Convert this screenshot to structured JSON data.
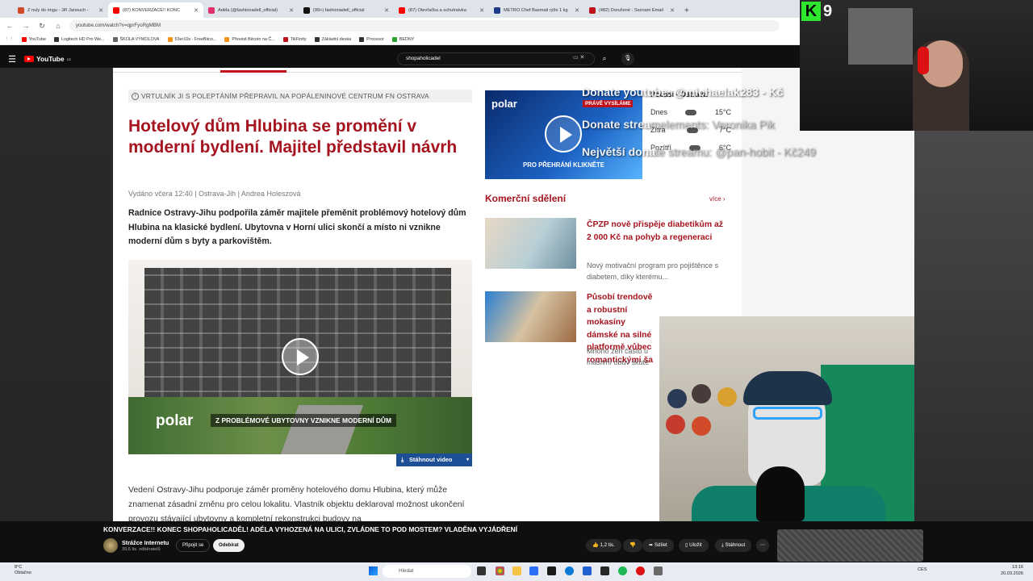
{
  "browser": {
    "tabs": [
      {
        "label": "Z nuly do ringu - Jiří Janouch -",
        "color": "#d04a2a",
        "active": false
      },
      {
        "label": "(87) KONVERZACE!! KONC",
        "color": "#ff0000",
        "active": true
      },
      {
        "label": "Adéla (@fashionadell_official)",
        "color": "#e1306c",
        "active": false
      },
      {
        "label": "(99+) fashionadell_official",
        "color": "#111111",
        "active": false
      },
      {
        "label": "(87) Otevřačka a ochutnávka",
        "color": "#ff0000",
        "active": false
      },
      {
        "label": "METRO Chef Basmati rýže 1 kg",
        "color": "#1a3a8a",
        "active": false
      },
      {
        "label": "(482) Doručené - Seznam Email",
        "color": "#c0121a",
        "active": false
      }
    ],
    "new_tab": "+",
    "url": "youtube.com/watch?v=qprFyoRgMBM",
    "bookmarks": [
      {
        "label": "YouTube",
        "color": "#ff0000"
      },
      {
        "label": "Logitech HD Pro We...",
        "color": "#333333"
      },
      {
        "label": "ŠKOLA VÝMOLOVA",
        "color": "#666666"
      },
      {
        "label": "53er10s - FreeBitco...",
        "color": "#f7931a"
      },
      {
        "label": "Převést Bitcoin na Č...",
        "color": "#f7931a"
      },
      {
        "label": "TikFinity",
        "color": "#c0121a"
      },
      {
        "label": "Základní deska",
        "color": "#333333"
      },
      {
        "label": "Procesor",
        "color": "#333333"
      },
      {
        "label": "BEDNY",
        "color": "#2ea02e"
      }
    ]
  },
  "youtube": {
    "logo": "YouTube",
    "logo_country": "CZ",
    "search_value": "shopaholicadel",
    "video_title": "KONVERZACE!! KONEC SHOPAHOLICADĚL! ADÉLA VYHOZENÁ NA ULICI, ZVLÁDNE TO POD MOSTEM? VLADĚNA VYJÁDŘENÍ",
    "channel_name": "Strážce Internetu",
    "channel_subs": "39,6 tis. odběratelů",
    "join_label": "Připojit se",
    "subscribe_label": "Odebírat",
    "actions": {
      "likes": "1,2 tis.",
      "share": "Sdílet",
      "save": "Uložit",
      "download": "Stáhnout",
      "more": "⋯"
    }
  },
  "article": {
    "info_bar": "VRTULNÍK JI S POLEPTÁNÍM PŘEPRAVIL NA POPÁLENINOVÉ CENTRUM FN OSTRAVA",
    "headline": "Hotelový dům Hlubina se promění v moderní bydlení. Majitel představil návrh",
    "byline": "Vydáno včera 12:40 | Ostrava-Jih | Andrea Holeszová",
    "perex": "Radnice Ostravy-Jihu podpořila záměr majitele přeměnit problémový hotelový dům Hlubina na klasické bydlení. Ubytovna v Horní ulici skončí a místo ni vznikne moderní dům s byty a parkovištěm.",
    "video_logo": "polar",
    "video_caption": "Z PROBLÉMOVÉ UBYTOVNY VZNIKNE MODERNÍ DŮM",
    "download_label": "Stáhnout video",
    "body": "Vedení Ostravy-Jihu podporuje záměr proměny hotelového domu Hlubina, který může znamenat zásadní změnu pro celou lokalitu. Vlastník objektu deklaroval možnost ukončení provozu stávající ubytovny a kompletní rekonstrukci budovy na"
  },
  "sidebar": {
    "ad": {
      "logo": "polar",
      "live_badge": "PRÁVĚ VYSÍLÁME",
      "caption": "PRO PŘEHRÁNÍ KLIKNĚTE"
    },
    "weather": {
      "title": "Počasí - Ostrava",
      "rows": [
        {
          "day": "Dnes",
          "temp": "15°C"
        },
        {
          "day": "Zítra",
          "temp": "7°C"
        },
        {
          "day": "Pozítří",
          "temp": "6°C"
        }
      ]
    },
    "section_title": "Komerční sdělení",
    "more_label": "více ›",
    "news": [
      {
        "title": "ČPZP nově přispěje diabetikům až 2 000 Kč na pohyb a regeneraci",
        "subtitle": "Nový motivační program pro pojištěnce s diabetem, díky kterému..."
      },
      {
        "title": "Působí trendově a robustní mokasíny dámské na silné platformě vůbec romantickými ša",
        "subtitle": "Mnoho žen často u masivní obuv skute"
      }
    ]
  },
  "stream_overlay": {
    "donate_lines": [
      {
        "bold": "Donate youtube: @michaelak283 - Kč",
        "faded": ""
      },
      {
        "bold": "Donate strea",
        "faded": "melements: Veronika Pik"
      },
      {
        "bold": "Největší dona",
        "faded": "te streamu: @pan-hobit - Kč249"
      }
    ],
    "cam_logo_k": "K",
    "cam_logo_num": "9"
  },
  "taskbar": {
    "weather_temp": "8°C",
    "weather_desc": "Oblačno",
    "search_placeholder": "Hledat",
    "lang": "CES",
    "time": "13:16",
    "date": "20.03.2026"
  },
  "colors": {
    "accent": "#a5141f",
    "download_btn": "#1d4f96",
    "youtube_red": "#ff0000"
  }
}
